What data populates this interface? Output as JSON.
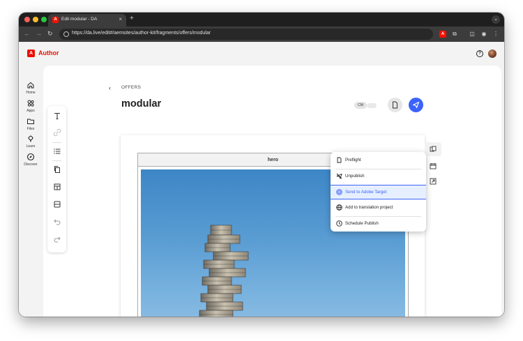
{
  "browser": {
    "tab_title": "Edit modular - DA",
    "tab_favicon": "A",
    "new_tab": "+",
    "tab_close": "×",
    "url": "https://da.live/edit#/aemsites/author-kit/fragments/offers/modular"
  },
  "app": {
    "brand_name": "Author",
    "brand_logo": "A"
  },
  "rail": {
    "items": [
      {
        "label": "Home",
        "icon": "home-icon"
      },
      {
        "label": "Apps",
        "icon": "apps-icon"
      },
      {
        "label": "Files",
        "icon": "folder-icon"
      },
      {
        "label": "Learn",
        "icon": "lightbulb-icon"
      },
      {
        "label": "Discover",
        "icon": "compass-icon"
      }
    ]
  },
  "document": {
    "breadcrumb": "OFFERS",
    "title": "modular",
    "cm_label": "CM",
    "block_name": "hero"
  },
  "publish_menu": {
    "items": [
      {
        "label": "Preflight",
        "icon": "document-icon",
        "active": false
      },
      {
        "label": "Unpublish",
        "icon": "unpublish-icon",
        "active": false
      },
      {
        "label": "Send to Adobe Target",
        "icon": "target-icon",
        "active": true
      },
      {
        "label": "Add to translation project",
        "icon": "globe-icon",
        "active": false
      },
      {
        "label": "Schedule Publish",
        "icon": "clock-icon",
        "active": false
      }
    ]
  },
  "colors": {
    "brand": "#eb1000",
    "accent": "#3b63fb",
    "active_bg": "#e6efff"
  }
}
